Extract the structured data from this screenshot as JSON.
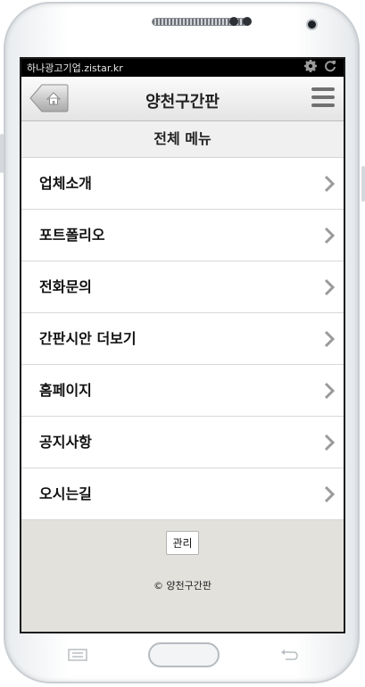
{
  "statusbar": {
    "app_label": "하나광고기업.zistar.kr",
    "icons": [
      "gear-icon",
      "refresh-icon"
    ]
  },
  "header": {
    "title": "양천구간판",
    "home_icon": "home-icon",
    "menu_icon": "hamburger-icon"
  },
  "section": {
    "title": "전체 메뉴"
  },
  "menu": {
    "items": [
      {
        "label": "업체소개"
      },
      {
        "label": "포트폴리오"
      },
      {
        "label": "전화문의"
      },
      {
        "label": "간판시안 더보기"
      },
      {
        "label": "홈페이지"
      },
      {
        "label": "공지사항"
      },
      {
        "label": "오시는길"
      }
    ]
  },
  "footer": {
    "admin_label": "관리",
    "copyright": "© 양천구간판"
  },
  "colors": {
    "status_bg": "#000000",
    "footer_bg": "#e2e1dc",
    "chevron": "#9a9a9a"
  }
}
